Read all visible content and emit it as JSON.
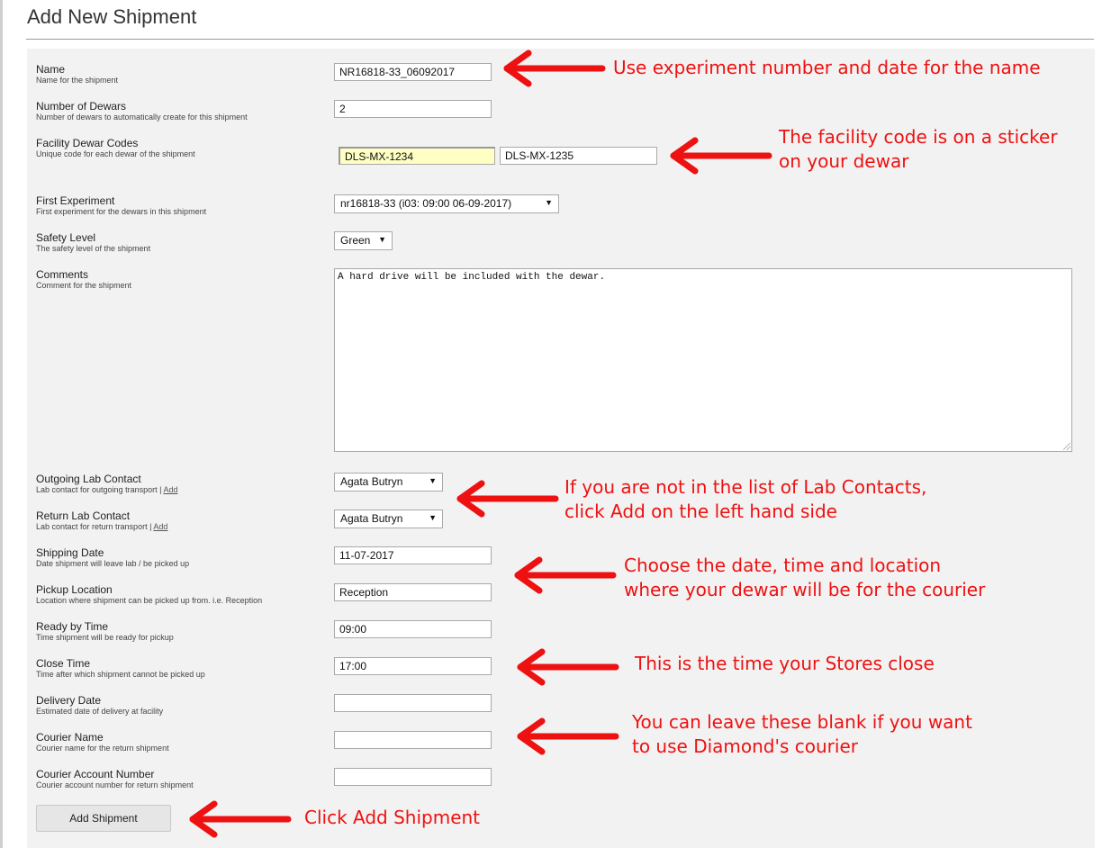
{
  "page": {
    "title": "Add New Shipment"
  },
  "fields": {
    "name": {
      "label": "Name",
      "help": "Name for the shipment",
      "value": "NR16818-33_06092017"
    },
    "dewars": {
      "label": "Number of Dewars",
      "help": "Number of dewars to automatically create for this shipment",
      "value": "2"
    },
    "facility_codes": {
      "label": "Facility Dewar Codes",
      "help": "Unique code for each dewar of the shipment",
      "values": [
        "DLS-MX-1234",
        "DLS-MX-1235"
      ]
    },
    "first_experiment": {
      "label": "First Experiment",
      "help": "First experiment for the dewars in this shipment",
      "value": "nr16818-33 (i03: 09:00 06-09-2017)"
    },
    "safety": {
      "label": "Safety Level",
      "help": "The safety level of the shipment",
      "value": "Green"
    },
    "comments": {
      "label": "Comments",
      "help": "Comment for the shipment",
      "value": "A hard drive will be included with the dewar."
    },
    "outgoing_contact": {
      "label": "Outgoing Lab Contact",
      "help": "Lab contact for outgoing transport |",
      "add": "Add",
      "value": "Agata Butryn"
    },
    "return_contact": {
      "label": "Return Lab Contact",
      "help": "Lab contact for return transport |",
      "add": "Add",
      "value": "Agata Butryn"
    },
    "shipping_date": {
      "label": "Shipping Date",
      "help": "Date shipment will leave lab / be picked up",
      "value": "11-07-2017"
    },
    "pickup_location": {
      "label": "Pickup Location",
      "help": "Location where shipment can be picked up from. i.e. Reception",
      "value": "Reception"
    },
    "ready_time": {
      "label": "Ready by Time",
      "help": "Time shipment will be ready for pickup",
      "value": "09:00"
    },
    "close_time": {
      "label": "Close Time",
      "help": "Time after which shipment cannot be picked up",
      "value": "17:00"
    },
    "delivery_date": {
      "label": "Delivery Date",
      "help": "Estimated date of delivery at facility",
      "value": ""
    },
    "courier_name": {
      "label": "Courier Name",
      "help": "Courier name for the return shipment",
      "value": ""
    },
    "courier_account": {
      "label": "Courier Account Number",
      "help": "Courier account number for return shipment",
      "value": ""
    }
  },
  "submit_label": "Add Shipment",
  "annotations": {
    "name": "Use experiment number and date for the name",
    "facility_1": "The facility code is on a sticker",
    "facility_2": "on your dewar",
    "contacts_1": "If you are not in the list of Lab Contacts,",
    "contacts_2": "click Add on the left hand side",
    "shipping_1": "Choose the date, time and location",
    "shipping_2": "where your dewar will be for the courier",
    "close": "This is the time your Stores close",
    "courier_1": "You can leave these blank if you want",
    "courier_2": "to use Diamond's courier",
    "submit": "Click Add Shipment"
  },
  "colors": {
    "annotation": "#ee1111",
    "highlight_input": "#ffffc4"
  }
}
